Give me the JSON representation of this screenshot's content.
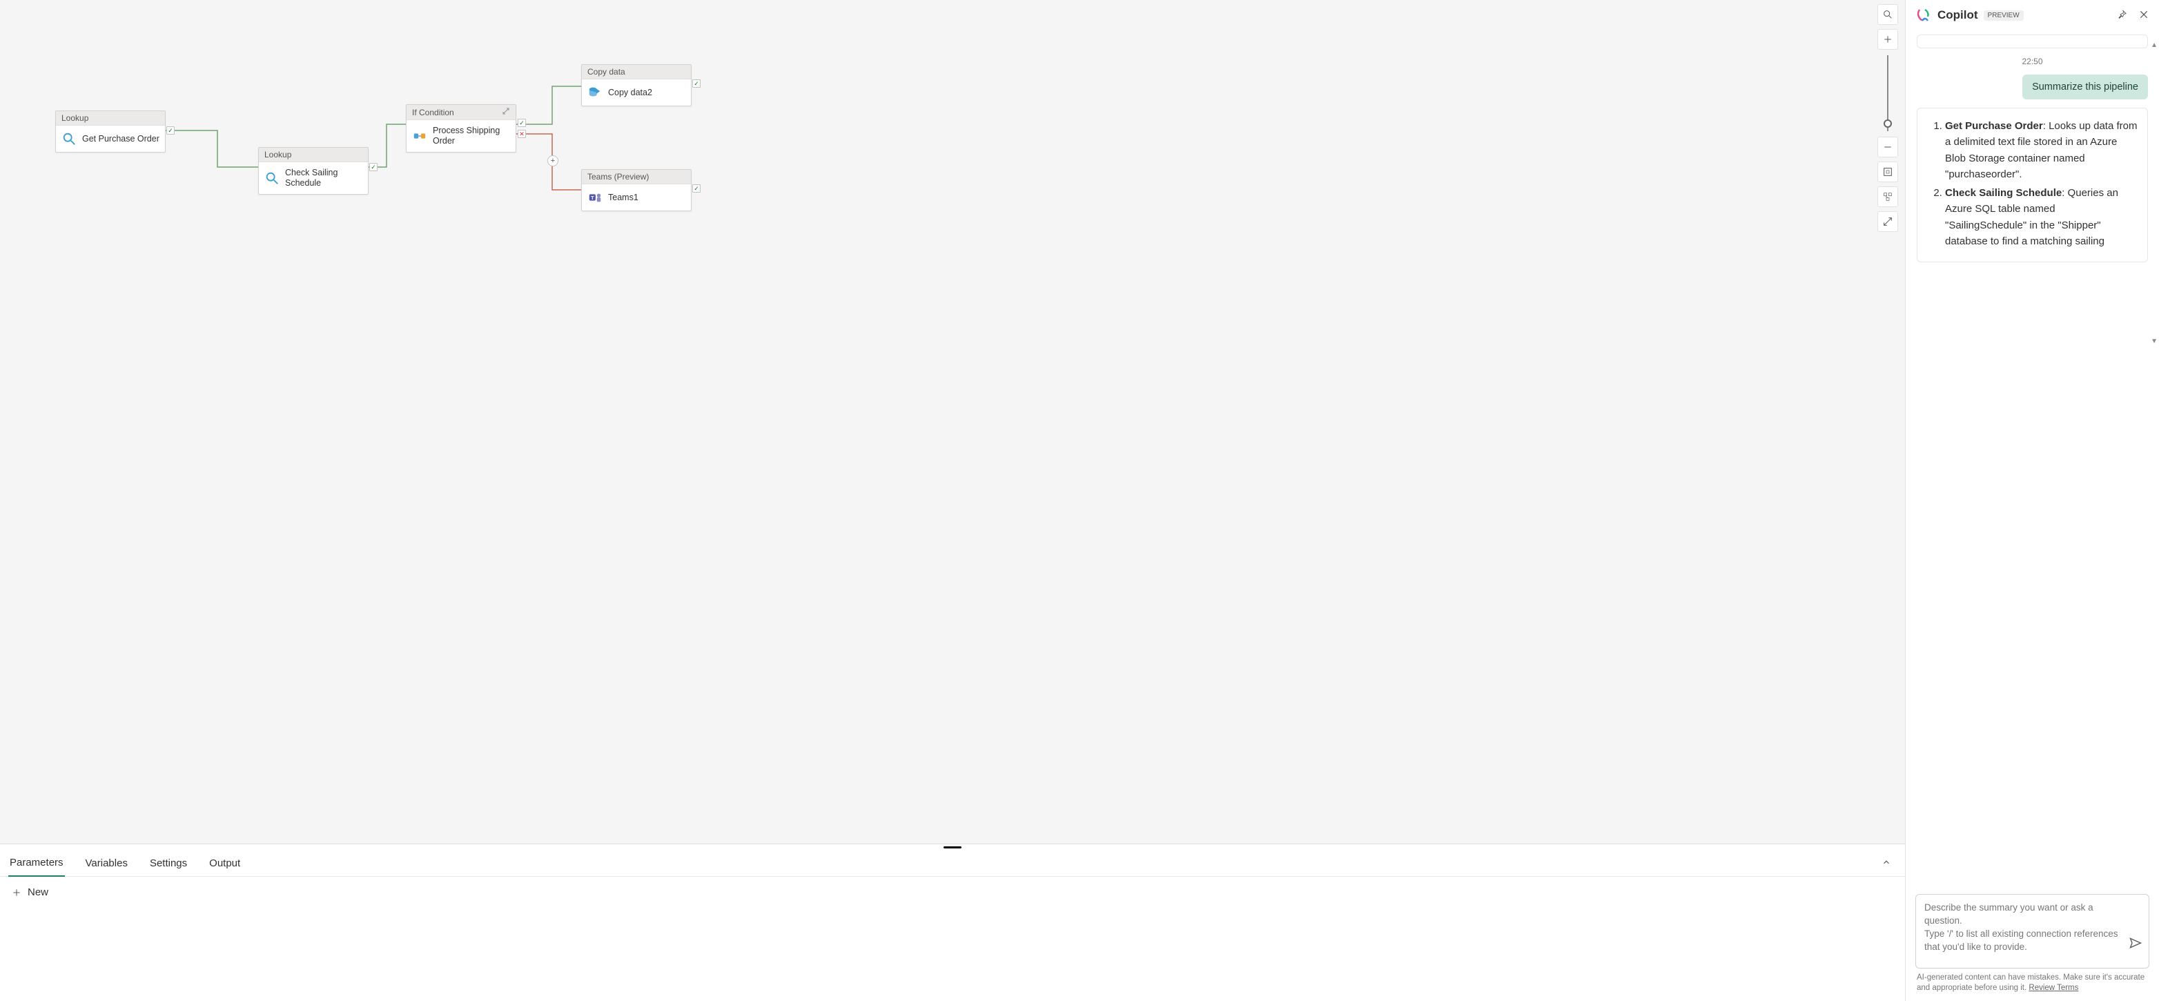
{
  "canvas": {
    "nodes": [
      {
        "type": "Lookup",
        "name": "Get Purchase Order",
        "icon": "lookup"
      },
      {
        "type": "Lookup",
        "name": "Check Sailing Schedule",
        "icon": "lookup"
      },
      {
        "type": "If Condition",
        "name": "Process Shipping Order",
        "icon": "ifcond",
        "expandable": true
      },
      {
        "type": "Copy data",
        "name": "Copy data2",
        "icon": "copydata"
      },
      {
        "type": "Teams (Preview)",
        "name": "Teams1",
        "icon": "teams"
      }
    ],
    "status_success": "✓",
    "status_fail": "✕",
    "plus": "+"
  },
  "toolbar": {
    "search": "search",
    "zoom_in": "+",
    "zoom_out": "−",
    "fit": "fit",
    "layout": "layout",
    "fullscreen": "fullscreen"
  },
  "bottom_panel": {
    "tabs": [
      "Parameters",
      "Variables",
      "Settings",
      "Output"
    ],
    "active_index": 0,
    "new_label": "New"
  },
  "copilot": {
    "title": "Copilot",
    "badge": "PREVIEW",
    "timestamp": "22:50",
    "user_message": "Summarize this pipeline",
    "assistant_list": [
      {
        "bold": "Get Purchase Order",
        "rest": ": Looks up data from a delimited text file stored in an Azure Blob Storage container named \"purchaseorder\"."
      },
      {
        "bold": "Check Sailing Schedule",
        "rest": ": Queries an Azure SQL table named \"SailingSchedule\" in the \"Shipper\" database to find a matching sailing"
      }
    ],
    "input_placeholder": "Describe the summary you want or ask a question.\nType '/' to list all existing connection references that you'd like to provide.",
    "disclaimer_pre": "AI-generated content can have mistakes. Make sure it's accurate and appropriate before using it. ",
    "disclaimer_link": "Review Terms"
  }
}
